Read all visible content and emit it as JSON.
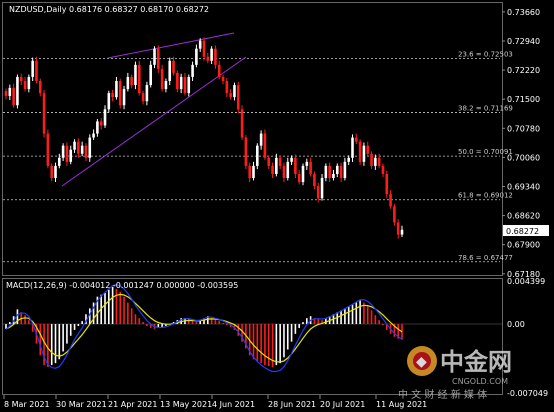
{
  "title": "NZDUSD,Daily  0.68176  0.68327  0.68170  0.68272",
  "macd_label": "MACD(12,26,9) -0.004012 -0.001247 0.000000 -0.003595",
  "current_price": "0.68272",
  "colors": {
    "bull": "#ffffff",
    "bear": "#ff1c1c",
    "channel": "#9b30d9",
    "signal": "#e6e600",
    "macd_line": "#1e3cff",
    "grid": "#cccccc"
  },
  "chart_data": [
    {
      "type": "candlestick",
      "symbol": "NZDUSD",
      "timeframe": "Daily",
      "price_axis_labels": [
        "0.73660",
        "0.72940",
        "0.72220",
        "0.71500",
        "0.70780",
        "0.70060",
        "0.69340",
        "0.68620",
        "0.67900",
        "0.67180"
      ],
      "ylim": [
        0.6715,
        0.7388
      ],
      "date_labels": [
        "8 Mar 2021",
        "30 Mar 2021",
        "21 Apr 2021",
        "13 May 2021",
        "4 Jun 2021",
        "28 Jun 2021",
        "20 Jul 2021",
        "11 Aug 2021"
      ],
      "fibonacci": [
        {
          "label": "23.6 = 0.72503",
          "value": 0.72503
        },
        {
          "label": "38.2 = 0.71169",
          "value": 0.71169
        },
        {
          "label": "50.0 = 0.70091",
          "value": 0.70091
        },
        {
          "label": "61.8 = 0.69012",
          "value": 0.69012
        },
        {
          "label": "78.6 = 0.67477",
          "value": 0.67477
        }
      ],
      "close_path": [
        0.7158,
        0.7178,
        0.7135,
        0.7205,
        0.7195,
        0.7175,
        0.7205,
        0.7245,
        0.7195,
        0.7165,
        0.7065,
        0.6985,
        0.6955,
        0.6985,
        0.7005,
        0.7035,
        0.6995,
        0.7025,
        0.7045,
        0.7015,
        0.7035,
        0.7005,
        0.7055,
        0.7065,
        0.7095,
        0.7085,
        0.7125,
        0.7165,
        0.7155,
        0.7195,
        0.7135,
        0.7175,
        0.7205,
        0.7185,
        0.7235,
        0.7165,
        0.7145,
        0.7185,
        0.7235,
        0.7275,
        0.7225,
        0.7175,
        0.7195,
        0.7245,
        0.7215,
        0.7175,
        0.7205,
        0.7165,
        0.7205,
        0.7235,
        0.7275,
        0.7295,
        0.7255,
        0.7245,
        0.7275,
        0.7235,
        0.7205,
        0.7195,
        0.7165,
        0.7155,
        0.7185,
        0.7125,
        0.7055,
        0.6985,
        0.6955,
        0.6985,
        0.7035,
        0.7065,
        0.7005,
        0.6985,
        0.6965,
        0.7005,
        0.6985,
        0.6955,
        0.6995,
        0.7005,
        0.6965,
        0.6945,
        0.6985,
        0.6995,
        0.6965,
        0.6935,
        0.6905,
        0.6955,
        0.6985,
        0.6955,
        0.6965,
        0.6985,
        0.6955,
        0.6995,
        0.7005,
        0.7055,
        0.7045,
        0.6995,
        0.7035,
        0.7015,
        0.6985,
        0.7005,
        0.6985,
        0.6965,
        0.6915,
        0.6885,
        0.6845,
        0.6815,
        0.6827
      ]
    },
    {
      "type": "macd",
      "params": "12,26,9",
      "axis_labels": [
        "0.004399",
        "0.00",
        "-0.007049"
      ],
      "ylim": [
        -0.00705,
        0.0044
      ],
      "histogram": [
        -0.0005,
        0.0002,
        0.0008,
        0.0015,
        0.0012,
        0.0009,
        0.0004,
        -0.0008,
        -0.002,
        -0.0032,
        -0.0042,
        -0.0044,
        -0.0042,
        -0.004,
        -0.0036,
        -0.0028,
        -0.002,
        -0.0012,
        -0.0006,
        -0.0002,
        0.0003,
        0.001,
        0.0016,
        0.0022,
        0.0028,
        0.003,
        0.0032,
        0.0035,
        0.0038,
        0.0036,
        0.0033,
        0.0028,
        0.0022,
        0.0016,
        0.001,
        0.0006,
        0.0002,
        -0.0002,
        -0.0004,
        -0.0005,
        -0.0004,
        -0.0003,
        -0.0002,
        0.0,
        0.0002,
        0.0004,
        0.0006,
        0.0006,
        0.0005,
        0.0003,
        0.0002,
        0.0004,
        0.0006,
        0.0008,
        0.0006,
        0.0004,
        0.0003,
        0.0001,
        -0.0001,
        -0.0003,
        -0.0006,
        -0.0012,
        -0.0018,
        -0.0025,
        -0.0032,
        -0.0036,
        -0.0038,
        -0.004,
        -0.0042,
        -0.0043,
        -0.0044,
        -0.0042,
        -0.004,
        -0.0034,
        -0.0026,
        -0.0018,
        -0.001,
        -0.0004,
        0.0002,
        0.0006,
        0.0008,
        0.0006,
        0.0005,
        0.0004,
        0.0006,
        0.0008,
        0.001,
        0.0012,
        0.0014,
        0.0016,
        0.0018,
        0.002,
        0.0022,
        0.0024,
        0.0022,
        0.0018,
        0.0014,
        0.0009,
        0.0004,
        -0.0001,
        -0.0006,
        -0.001,
        -0.0013,
        -0.0015,
        -0.0016
      ]
    }
  ],
  "watermark": {
    "logo_glyph": "◆",
    "name": "中金网",
    "domain": "CNGOLD.COM",
    "tagline": "中 文 财 经 新 媒 体"
  }
}
